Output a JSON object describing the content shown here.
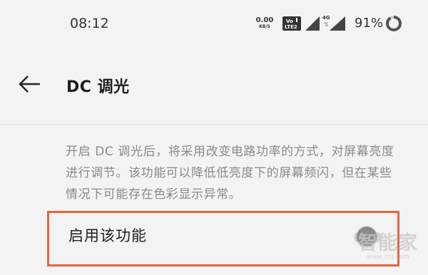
{
  "status_bar": {
    "time": "08:12",
    "net_speed_value": "0.00",
    "net_speed_unit": "KB/S",
    "network_type": "4G",
    "battery_percent": "91%",
    "battery_level": 0.91,
    "icons": [
      "volte-icon",
      "signal-icon",
      "signal-icon",
      "battery-icon"
    ]
  },
  "header": {
    "title": "DC 调光",
    "back_icon": "back-arrow-icon"
  },
  "description": "开启 DC 调光后，将采用改变电路功率的方式，对屏幕亮度进行调节。该功能可以降低低亮度下的屏幕频闪，但在某些情况下可能存在色彩显示异常。",
  "setting": {
    "label": "启用该功能",
    "enabled": false,
    "highlight_color": "#e8643a"
  },
  "watermark": {
    "main": "智能家",
    "url": "www.znj.com"
  }
}
